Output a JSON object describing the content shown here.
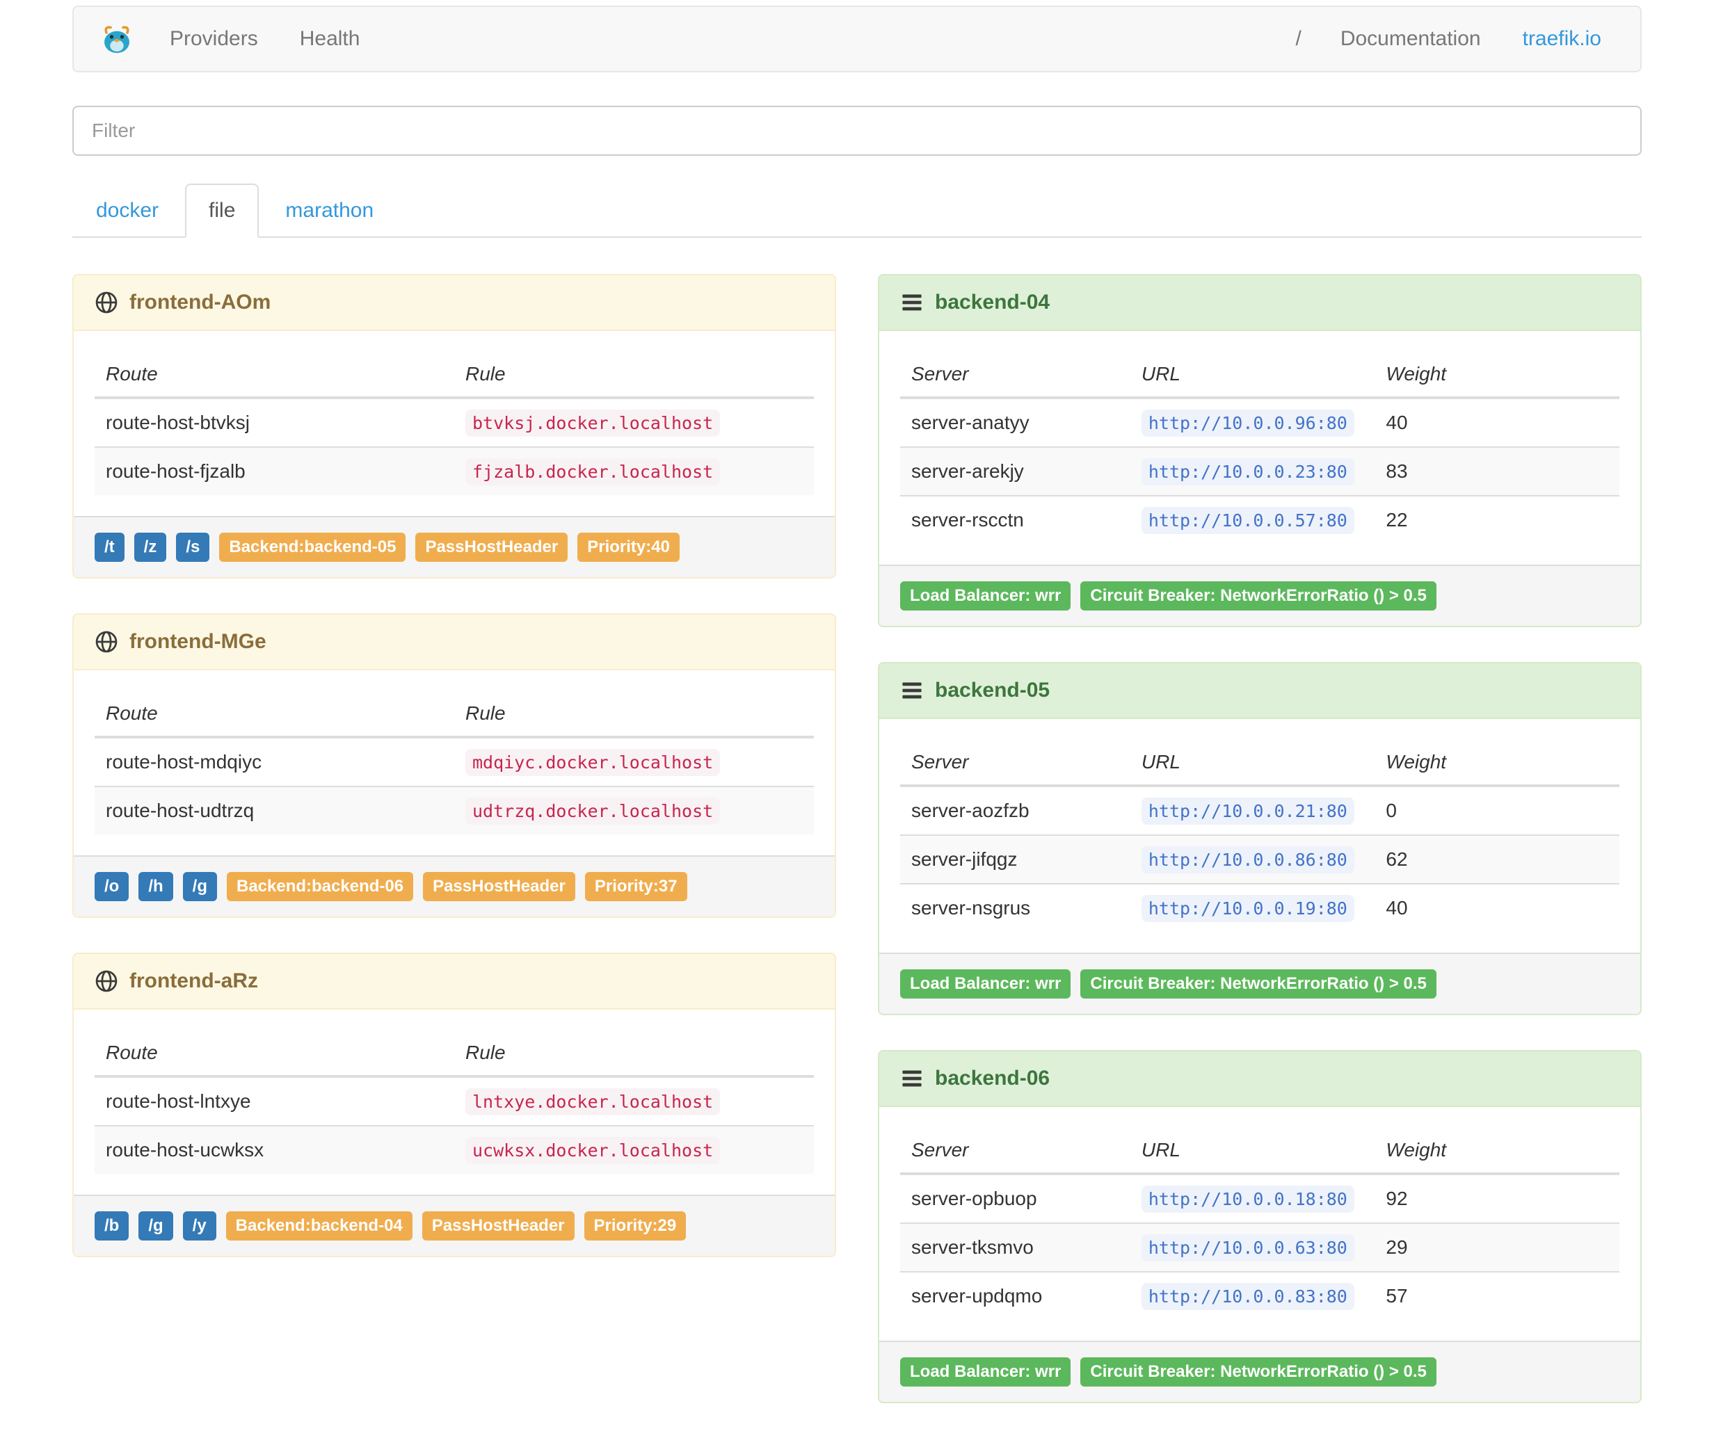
{
  "navbar": {
    "providers_label": "Providers",
    "health_label": "Health",
    "separator": "/",
    "documentation_label": "Documentation",
    "traefik_link_label": "traefik.io"
  },
  "filter": {
    "placeholder": "Filter"
  },
  "tabs": [
    {
      "label": "docker",
      "active": false
    },
    {
      "label": "file",
      "active": true
    },
    {
      "label": "marathon",
      "active": false
    }
  ],
  "icons": {
    "brand": "traefik-logo",
    "frontend_header": "globe-icon",
    "backend_header": "server-list-icon"
  },
  "colors": {
    "link_blue": "#3498db",
    "entrypoint_badge": "#337ab7",
    "frontend_badge": "#f0ad4e",
    "backend_badge": "#5cb85c",
    "rule_code": "#c7254e",
    "url_code": "#4273c8",
    "frontend_header_bg": "#fcf8e3",
    "backend_header_bg": "#dff0d8"
  },
  "frontends": [
    {
      "title": "frontend-AOm",
      "columns": [
        "Route",
        "Rule"
      ],
      "routes": [
        {
          "route": "route-host-btvksj",
          "rule": "btvksj.docker.localhost"
        },
        {
          "route": "route-host-fjzalb",
          "rule": "fjzalb.docker.localhost"
        }
      ],
      "entry_points": [
        "/t",
        "/z",
        "/s"
      ],
      "badges": [
        "Backend:backend-05",
        "PassHostHeader",
        "Priority:40"
      ]
    },
    {
      "title": "frontend-MGe",
      "columns": [
        "Route",
        "Rule"
      ],
      "routes": [
        {
          "route": "route-host-mdqiyc",
          "rule": "mdqiyc.docker.localhost"
        },
        {
          "route": "route-host-udtrzq",
          "rule": "udtrzq.docker.localhost"
        }
      ],
      "entry_points": [
        "/o",
        "/h",
        "/g"
      ],
      "badges": [
        "Backend:backend-06",
        "PassHostHeader",
        "Priority:37"
      ]
    },
    {
      "title": "frontend-aRz",
      "columns": [
        "Route",
        "Rule"
      ],
      "routes": [
        {
          "route": "route-host-lntxye",
          "rule": "lntxye.docker.localhost"
        },
        {
          "route": "route-host-ucwksx",
          "rule": "ucwksx.docker.localhost"
        }
      ],
      "entry_points": [
        "/b",
        "/g",
        "/y"
      ],
      "badges": [
        "Backend:backend-04",
        "PassHostHeader",
        "Priority:29"
      ]
    }
  ],
  "backends": [
    {
      "title": "backend-04",
      "columns": [
        "Server",
        "URL",
        "Weight"
      ],
      "servers": [
        {
          "server": "server-anatyy",
          "url": "http://10.0.0.96:80",
          "weight": 40
        },
        {
          "server": "server-arekjy",
          "url": "http://10.0.0.23:80",
          "weight": 83
        },
        {
          "server": "server-rscctn",
          "url": "http://10.0.0.57:80",
          "weight": 22
        }
      ],
      "badges": [
        "Load Balancer: wrr",
        "Circuit Breaker: NetworkErrorRatio () > 0.5"
      ]
    },
    {
      "title": "backend-05",
      "columns": [
        "Server",
        "URL",
        "Weight"
      ],
      "servers": [
        {
          "server": "server-aozfzb",
          "url": "http://10.0.0.21:80",
          "weight": 0
        },
        {
          "server": "server-jifqgz",
          "url": "http://10.0.0.86:80",
          "weight": 62
        },
        {
          "server": "server-nsgrus",
          "url": "http://10.0.0.19:80",
          "weight": 40
        }
      ],
      "badges": [
        "Load Balancer: wrr",
        "Circuit Breaker: NetworkErrorRatio () > 0.5"
      ]
    },
    {
      "title": "backend-06",
      "columns": [
        "Server",
        "URL",
        "Weight"
      ],
      "servers": [
        {
          "server": "server-opbuop",
          "url": "http://10.0.0.18:80",
          "weight": 92
        },
        {
          "server": "server-tksmvo",
          "url": "http://10.0.0.63:80",
          "weight": 29
        },
        {
          "server": "server-updqmo",
          "url": "http://10.0.0.83:80",
          "weight": 57
        }
      ],
      "badges": [
        "Load Balancer: wrr",
        "Circuit Breaker: NetworkErrorRatio () > 0.5"
      ]
    }
  ]
}
